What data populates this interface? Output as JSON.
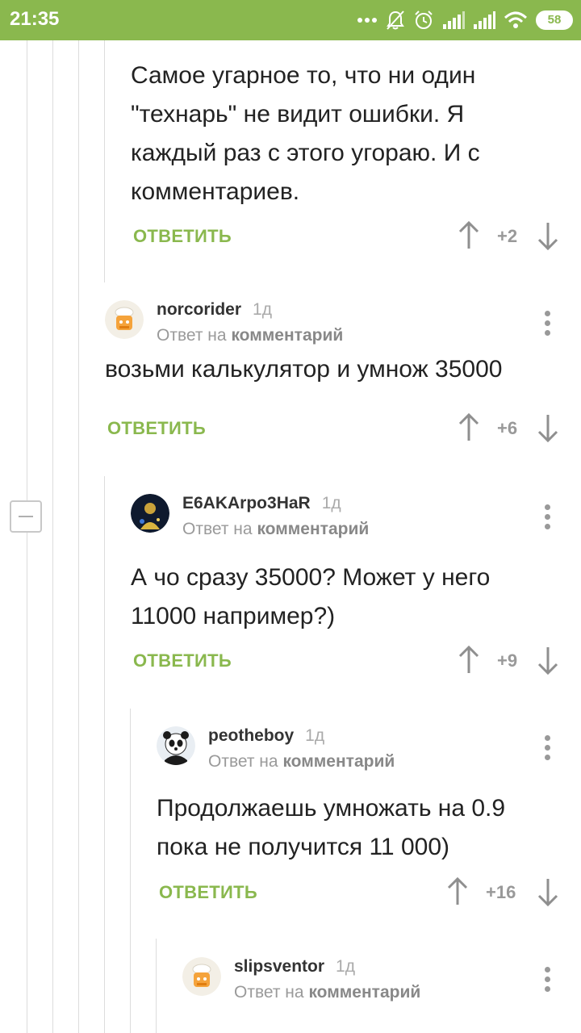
{
  "status_bar": {
    "time": "21:35",
    "battery": "58",
    "icons": [
      "more-dots-icon",
      "mute-bell-icon",
      "alarm-icon",
      "signal-icon",
      "signal-icon",
      "wifi-icon",
      "battery-icon"
    ]
  },
  "colors": {
    "accent": "#8ab84e",
    "muted": "#999999",
    "line": "#dcdcdc"
  },
  "comments": [
    {
      "text": "Самое угарное то, что ни один \"технарь\" не видит ошибки. Я каждый раз с этого угораю. И с комментариев.",
      "reply_label": "ОТВЕТИТЬ",
      "score": "+2"
    },
    {
      "author": "norcorider",
      "age": "1д",
      "reply_prefix": "Ответ на",
      "reply_link": "комментарий",
      "text": "возьми калькулятор и умнож 35000",
      "reply_label": "ОТВЕТИТЬ",
      "score": "+6",
      "avatar_icon": "default-cook-avatar-icon"
    },
    {
      "author": "E6AKArpo3HaR",
      "age": "1д",
      "reply_prefix": "Ответ на",
      "reply_link": "комментарий",
      "text": "А чо сразу 35000? Может у него 11000 например?)",
      "reply_label": "ОТВЕТИТЬ",
      "score": "+9",
      "avatar_icon": "user-photo-avatar-icon"
    },
    {
      "author": "peotheboy",
      "age": "1д",
      "reply_prefix": "Ответ на",
      "reply_link": "комментарий",
      "text": "Продолжаешь умножать на 0.9 пока не получится 11 000)",
      "reply_label": "ОТВЕТИТЬ",
      "score": "+16",
      "avatar_icon": "panda-avatar-icon"
    },
    {
      "author": "slipsventor",
      "age": "1д",
      "reply_prefix": "Ответ на",
      "reply_link": "комментарий",
      "avatar_icon": "default-cook-avatar-icon"
    }
  ]
}
